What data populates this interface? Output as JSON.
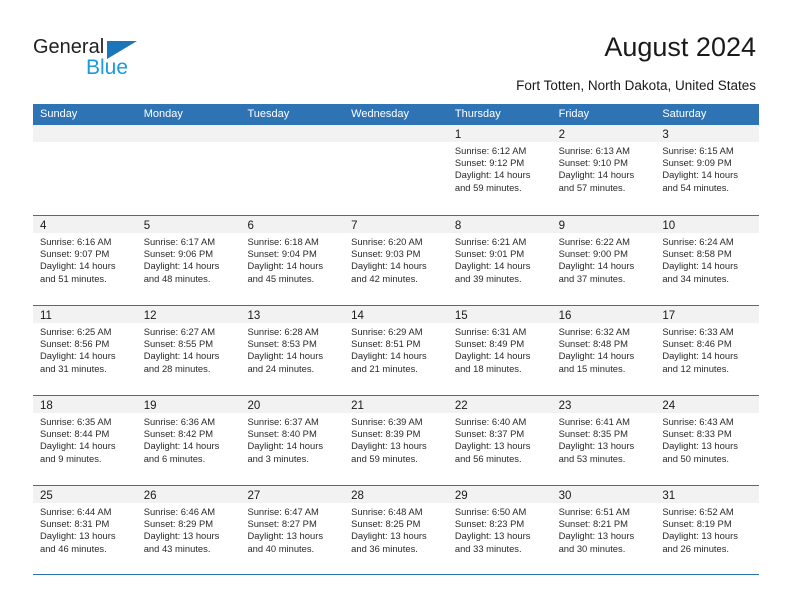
{
  "brand": {
    "name_part1": "General",
    "name_part2": "Blue",
    "triangle_icon": "blue-triangle-logo-mark"
  },
  "header": {
    "title": "August 2024",
    "subtitle": "Fort Totten, North Dakota, United States"
  },
  "colors": {
    "header_blue": "#2e74b5",
    "day_band_gray": "#f2f2f2",
    "brand_dark": "#231f20",
    "brand_blue": "#1b9ae0",
    "logo_triangle_blue": "#1b75bb"
  },
  "weekdays": [
    "Sunday",
    "Monday",
    "Tuesday",
    "Wednesday",
    "Thursday",
    "Friday",
    "Saturday"
  ],
  "weeks": [
    [
      {
        "day": "",
        "sunrise": "",
        "sunset": "",
        "daylight_line1": "",
        "daylight_line2": "",
        "empty": true
      },
      {
        "day": "",
        "sunrise": "",
        "sunset": "",
        "daylight_line1": "",
        "daylight_line2": "",
        "empty": true
      },
      {
        "day": "",
        "sunrise": "",
        "sunset": "",
        "daylight_line1": "",
        "daylight_line2": "",
        "empty": true
      },
      {
        "day": "",
        "sunrise": "",
        "sunset": "",
        "daylight_line1": "",
        "daylight_line2": "",
        "empty": true
      },
      {
        "day": "1",
        "sunrise": "Sunrise: 6:12 AM",
        "sunset": "Sunset: 9:12 PM",
        "daylight_line1": "Daylight: 14 hours",
        "daylight_line2": "and 59 minutes."
      },
      {
        "day": "2",
        "sunrise": "Sunrise: 6:13 AM",
        "sunset": "Sunset: 9:10 PM",
        "daylight_line1": "Daylight: 14 hours",
        "daylight_line2": "and 57 minutes."
      },
      {
        "day": "3",
        "sunrise": "Sunrise: 6:15 AM",
        "sunset": "Sunset: 9:09 PM",
        "daylight_line1": "Daylight: 14 hours",
        "daylight_line2": "and 54 minutes."
      }
    ],
    [
      {
        "day": "4",
        "sunrise": "Sunrise: 6:16 AM",
        "sunset": "Sunset: 9:07 PM",
        "daylight_line1": "Daylight: 14 hours",
        "daylight_line2": "and 51 minutes."
      },
      {
        "day": "5",
        "sunrise": "Sunrise: 6:17 AM",
        "sunset": "Sunset: 9:06 PM",
        "daylight_line1": "Daylight: 14 hours",
        "daylight_line2": "and 48 minutes."
      },
      {
        "day": "6",
        "sunrise": "Sunrise: 6:18 AM",
        "sunset": "Sunset: 9:04 PM",
        "daylight_line1": "Daylight: 14 hours",
        "daylight_line2": "and 45 minutes."
      },
      {
        "day": "7",
        "sunrise": "Sunrise: 6:20 AM",
        "sunset": "Sunset: 9:03 PM",
        "daylight_line1": "Daylight: 14 hours",
        "daylight_line2": "and 42 minutes."
      },
      {
        "day": "8",
        "sunrise": "Sunrise: 6:21 AM",
        "sunset": "Sunset: 9:01 PM",
        "daylight_line1": "Daylight: 14 hours",
        "daylight_line2": "and 39 minutes."
      },
      {
        "day": "9",
        "sunrise": "Sunrise: 6:22 AM",
        "sunset": "Sunset: 9:00 PM",
        "daylight_line1": "Daylight: 14 hours",
        "daylight_line2": "and 37 minutes."
      },
      {
        "day": "10",
        "sunrise": "Sunrise: 6:24 AM",
        "sunset": "Sunset: 8:58 PM",
        "daylight_line1": "Daylight: 14 hours",
        "daylight_line2": "and 34 minutes."
      }
    ],
    [
      {
        "day": "11",
        "sunrise": "Sunrise: 6:25 AM",
        "sunset": "Sunset: 8:56 PM",
        "daylight_line1": "Daylight: 14 hours",
        "daylight_line2": "and 31 minutes."
      },
      {
        "day": "12",
        "sunrise": "Sunrise: 6:27 AM",
        "sunset": "Sunset: 8:55 PM",
        "daylight_line1": "Daylight: 14 hours",
        "daylight_line2": "and 28 minutes."
      },
      {
        "day": "13",
        "sunrise": "Sunrise: 6:28 AM",
        "sunset": "Sunset: 8:53 PM",
        "daylight_line1": "Daylight: 14 hours",
        "daylight_line2": "and 24 minutes."
      },
      {
        "day": "14",
        "sunrise": "Sunrise: 6:29 AM",
        "sunset": "Sunset: 8:51 PM",
        "daylight_line1": "Daylight: 14 hours",
        "daylight_line2": "and 21 minutes."
      },
      {
        "day": "15",
        "sunrise": "Sunrise: 6:31 AM",
        "sunset": "Sunset: 8:49 PM",
        "daylight_line1": "Daylight: 14 hours",
        "daylight_line2": "and 18 minutes."
      },
      {
        "day": "16",
        "sunrise": "Sunrise: 6:32 AM",
        "sunset": "Sunset: 8:48 PM",
        "daylight_line1": "Daylight: 14 hours",
        "daylight_line2": "and 15 minutes."
      },
      {
        "day": "17",
        "sunrise": "Sunrise: 6:33 AM",
        "sunset": "Sunset: 8:46 PM",
        "daylight_line1": "Daylight: 14 hours",
        "daylight_line2": "and 12 minutes."
      }
    ],
    [
      {
        "day": "18",
        "sunrise": "Sunrise: 6:35 AM",
        "sunset": "Sunset: 8:44 PM",
        "daylight_line1": "Daylight: 14 hours",
        "daylight_line2": "and 9 minutes."
      },
      {
        "day": "19",
        "sunrise": "Sunrise: 6:36 AM",
        "sunset": "Sunset: 8:42 PM",
        "daylight_line1": "Daylight: 14 hours",
        "daylight_line2": "and 6 minutes."
      },
      {
        "day": "20",
        "sunrise": "Sunrise: 6:37 AM",
        "sunset": "Sunset: 8:40 PM",
        "daylight_line1": "Daylight: 14 hours",
        "daylight_line2": "and 3 minutes."
      },
      {
        "day": "21",
        "sunrise": "Sunrise: 6:39 AM",
        "sunset": "Sunset: 8:39 PM",
        "daylight_line1": "Daylight: 13 hours",
        "daylight_line2": "and 59 minutes."
      },
      {
        "day": "22",
        "sunrise": "Sunrise: 6:40 AM",
        "sunset": "Sunset: 8:37 PM",
        "daylight_line1": "Daylight: 13 hours",
        "daylight_line2": "and 56 minutes."
      },
      {
        "day": "23",
        "sunrise": "Sunrise: 6:41 AM",
        "sunset": "Sunset: 8:35 PM",
        "daylight_line1": "Daylight: 13 hours",
        "daylight_line2": "and 53 minutes."
      },
      {
        "day": "24",
        "sunrise": "Sunrise: 6:43 AM",
        "sunset": "Sunset: 8:33 PM",
        "daylight_line1": "Daylight: 13 hours",
        "daylight_line2": "and 50 minutes."
      }
    ],
    [
      {
        "day": "25",
        "sunrise": "Sunrise: 6:44 AM",
        "sunset": "Sunset: 8:31 PM",
        "daylight_line1": "Daylight: 13 hours",
        "daylight_line2": "and 46 minutes."
      },
      {
        "day": "26",
        "sunrise": "Sunrise: 6:46 AM",
        "sunset": "Sunset: 8:29 PM",
        "daylight_line1": "Daylight: 13 hours",
        "daylight_line2": "and 43 minutes."
      },
      {
        "day": "27",
        "sunrise": "Sunrise: 6:47 AM",
        "sunset": "Sunset: 8:27 PM",
        "daylight_line1": "Daylight: 13 hours",
        "daylight_line2": "and 40 minutes."
      },
      {
        "day": "28",
        "sunrise": "Sunrise: 6:48 AM",
        "sunset": "Sunset: 8:25 PM",
        "daylight_line1": "Daylight: 13 hours",
        "daylight_line2": "and 36 minutes."
      },
      {
        "day": "29",
        "sunrise": "Sunrise: 6:50 AM",
        "sunset": "Sunset: 8:23 PM",
        "daylight_line1": "Daylight: 13 hours",
        "daylight_line2": "and 33 minutes."
      },
      {
        "day": "30",
        "sunrise": "Sunrise: 6:51 AM",
        "sunset": "Sunset: 8:21 PM",
        "daylight_line1": "Daylight: 13 hours",
        "daylight_line2": "and 30 minutes."
      },
      {
        "day": "31",
        "sunrise": "Sunrise: 6:52 AM",
        "sunset": "Sunset: 8:19 PM",
        "daylight_line1": "Daylight: 13 hours",
        "daylight_line2": "and 26 minutes."
      }
    ]
  ]
}
